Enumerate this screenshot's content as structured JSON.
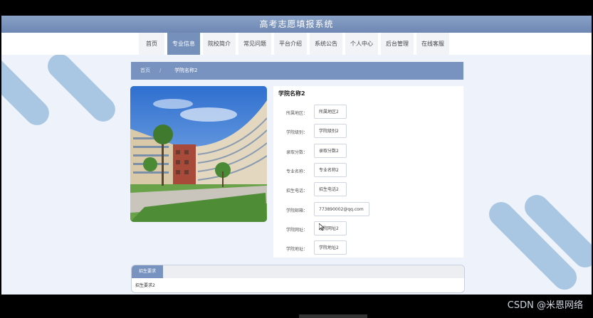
{
  "header": {
    "title": "高考志愿填报系统"
  },
  "nav": [
    {
      "label": "首页",
      "width": 36,
      "active": false
    },
    {
      "label": "专业信息",
      "width": 46,
      "active": true
    },
    {
      "label": "院校简介",
      "width": 46,
      "active": false
    },
    {
      "label": "常见问题",
      "width": 46,
      "active": false
    },
    {
      "label": "平台介绍",
      "width": 46,
      "active": false
    },
    {
      "label": "系统公告",
      "width": 46,
      "active": false
    },
    {
      "label": "个人中心",
      "width": 46,
      "active": false
    },
    {
      "label": "后台管理",
      "width": 46,
      "active": false
    },
    {
      "label": "在线客服",
      "width": 46,
      "active": false
    }
  ],
  "breadcrumb": {
    "home": "首页",
    "separator": "/",
    "current": "学院名称2"
  },
  "detail": {
    "title": "学院名称2",
    "fields": [
      {
        "label": "所属地区：",
        "value": "所属地区2"
      },
      {
        "label": "学院级别：",
        "value": "学院级别2"
      },
      {
        "label": "录取分数：",
        "value": "录取分数2"
      },
      {
        "label": "专业名称：",
        "value": "专业名称2"
      },
      {
        "label": "招生电话：",
        "value": "招生电话2"
      },
      {
        "label": "学院邮箱：",
        "value": "773890002@qq.com"
      },
      {
        "label": "学院网址：",
        "value": "学院网址2"
      },
      {
        "label": "学院地址：",
        "value": "学院地址2"
      }
    ]
  },
  "requirements": {
    "tab": "招生要求",
    "content": "招生要求2"
  },
  "watermark": "CSDN @米恩网络",
  "colors": {
    "primary": "#7590bb",
    "header": "#7b94bf",
    "page_bg": "#eef2fb",
    "decor": "#a9c7e3"
  }
}
